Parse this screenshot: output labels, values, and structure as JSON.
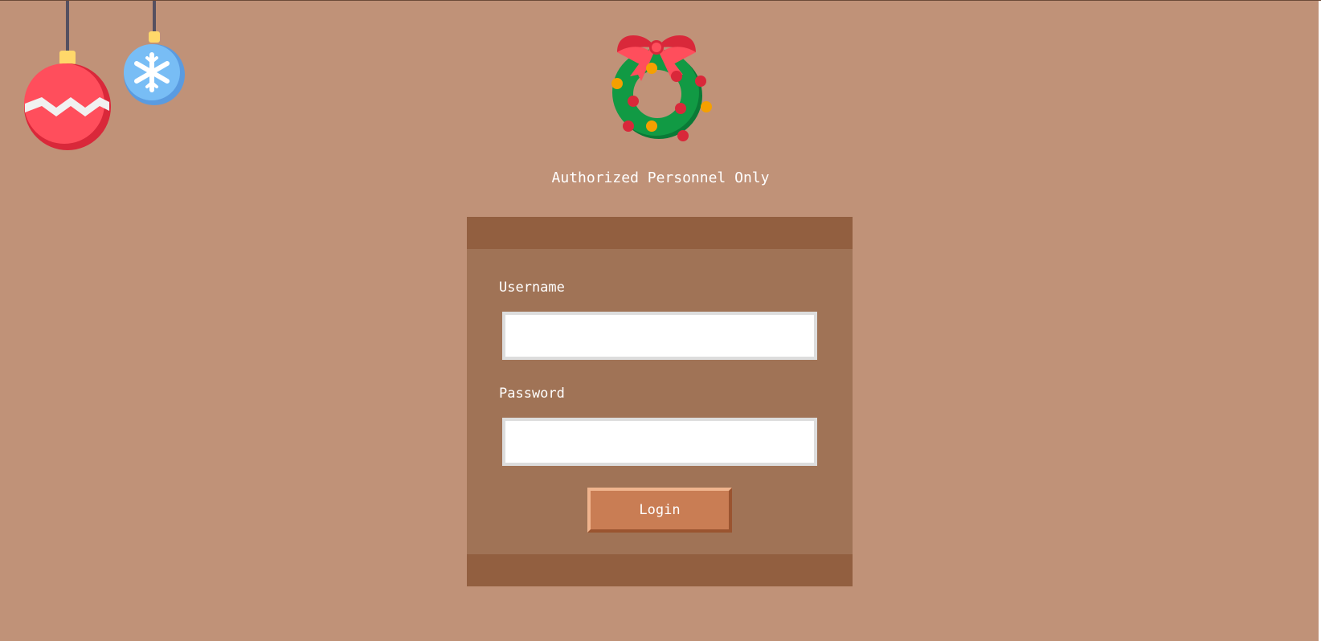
{
  "page": {
    "heading": "Authorized Personnel Only"
  },
  "decorations": {
    "left_ornament_icon": "red-christmas-ornament-icon",
    "right_ornament_icon": "blue-snowflake-ornament-icon",
    "top_icon": "christmas-wreath-icon"
  },
  "login_form": {
    "username_label": "Username",
    "username_value": "",
    "password_label": "Password",
    "password_value": "",
    "login_button_label": "Login"
  },
  "colors": {
    "background": "#c09278",
    "panel": "#a07356",
    "panel_band": "#925f40",
    "button": "#c97d54"
  }
}
